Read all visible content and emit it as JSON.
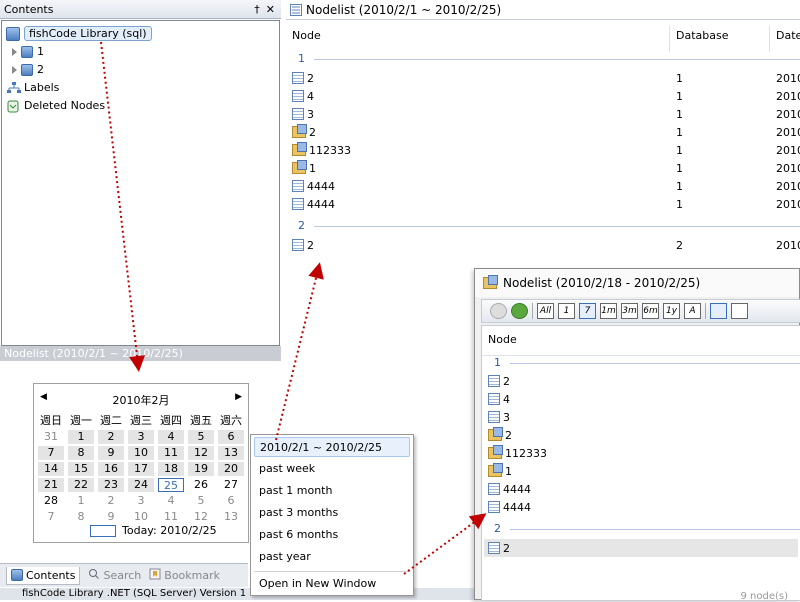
{
  "left_panel": {
    "title": "Contents",
    "pin": "†",
    "close": "✕",
    "tree": {
      "root": "fishCode Library (sql)",
      "item1": "1",
      "item2": "2",
      "labels": "Labels",
      "deleted": "Deleted Nodes"
    },
    "nodelist_bar": "Nodelist (2010/2/1 ~ 2010/2/25)"
  },
  "calendar": {
    "month": "2010年2月",
    "weekdays": [
      "週日",
      "週一",
      "週二",
      "週三",
      "週四",
      "週五",
      "週六"
    ],
    "weeks": [
      [
        "31",
        "1",
        "2",
        "3",
        "4",
        "5",
        "6"
      ],
      [
        "7",
        "8",
        "9",
        "10",
        "11",
        "12",
        "13"
      ],
      [
        "14",
        "15",
        "16",
        "17",
        "18",
        "19",
        "20"
      ],
      [
        "21",
        "22",
        "23",
        "24",
        "25",
        "26",
        "27"
      ],
      [
        "28",
        "1",
        "2",
        "3",
        "4",
        "5",
        "6"
      ],
      [
        "7",
        "8",
        "9",
        "10",
        "11",
        "12",
        "13"
      ]
    ],
    "today_label": "Today: 2010/2/25"
  },
  "tabs": {
    "contents": "Contents",
    "search": "Search",
    "bookmark": "Bookmark"
  },
  "status": "fishCode Library .NET (SQL Server) Version 1",
  "main": {
    "title": "Nodelist (2010/2/1 ~ 2010/2/25)",
    "col_node": "Node",
    "col_db": "Database",
    "col_date": "Date",
    "group1": "1",
    "group2": "2",
    "rows": [
      {
        "name": "2",
        "db": "1",
        "date": "2010"
      },
      {
        "name": "4",
        "db": "1",
        "date": "2010"
      },
      {
        "name": "3",
        "db": "1",
        "date": "2010"
      },
      {
        "name": "2",
        "db": "1",
        "date": "2010"
      },
      {
        "name": "112333",
        "db": "1",
        "date": "2010"
      },
      {
        "name": "1",
        "db": "1",
        "date": "2010"
      },
      {
        "name": "4444",
        "db": "1",
        "date": "2010"
      },
      {
        "name": "4444",
        "db": "1",
        "date": "2010"
      }
    ],
    "row_g2": {
      "name": "2",
      "db": "2",
      "date": "2010"
    }
  },
  "menu": {
    "items": [
      "2010/2/1 ~ 2010/2/25",
      "past week",
      "past 1 month",
      "past 3 months",
      "past 6 months",
      "past year"
    ],
    "open_new": "Open in New Window"
  },
  "win2": {
    "title": "Nodelist (2010/2/18 - 2010/2/25)",
    "tools": [
      "All",
      "1",
      "7",
      "1m",
      "3m",
      "6m",
      "1y",
      "A"
    ],
    "col_node": "Node",
    "group1": "1",
    "group2": "2",
    "rows": [
      "2",
      "4",
      "3",
      "2",
      "112333",
      "1",
      "4444",
      "4444"
    ],
    "row_g2": "2",
    "footer": "9 node(s)"
  }
}
